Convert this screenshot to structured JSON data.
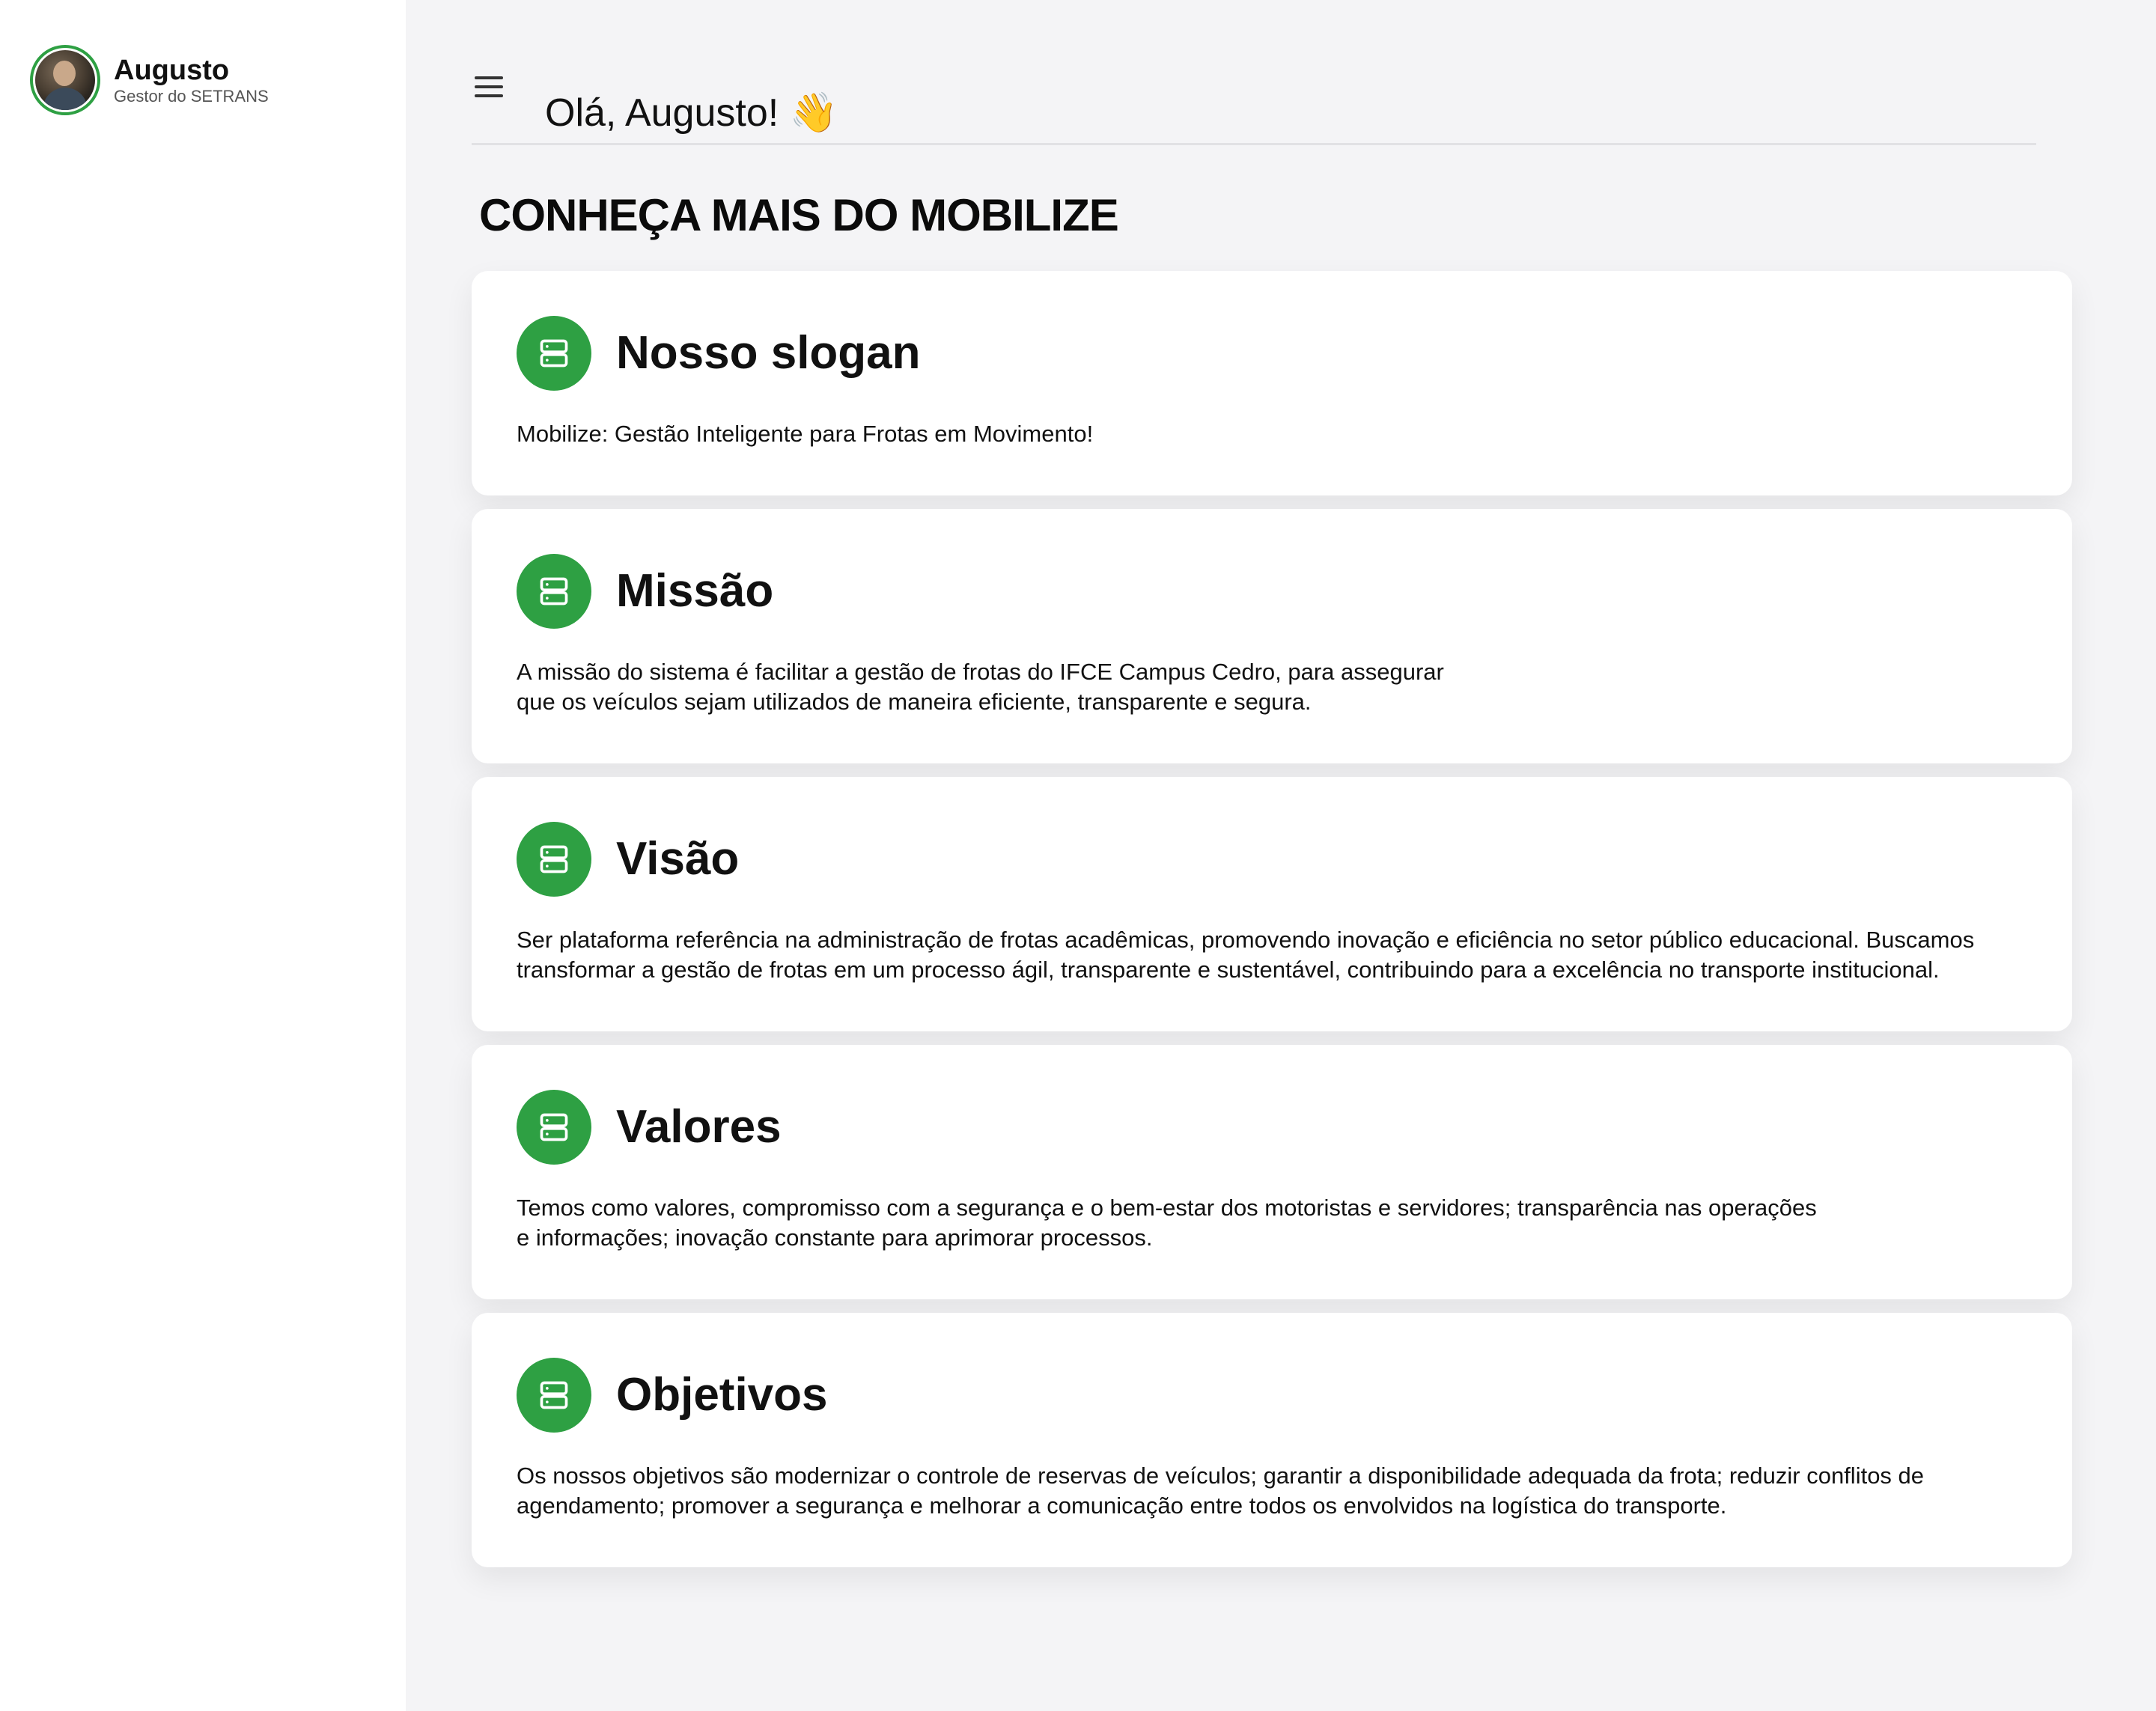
{
  "user": {
    "name": "Augusto",
    "role": "Gestor do SETRANS"
  },
  "header": {
    "greeting": "Olá, Augusto! 👋"
  },
  "main": {
    "section_title": "CONHEÇA MAIS DO MOBILIZE",
    "cards": [
      {
        "title": "Nosso slogan",
        "lines": [
          "Mobilize: Gestão Inteligente para Frotas em Movimento!"
        ]
      },
      {
        "title": "Missão",
        "lines": [
          "A missão do sistema é facilitar a gestão de frotas do IFCE Campus Cedro, para assegurar",
          "que os veículos sejam utilizados de maneira eficiente, transparente e segura."
        ]
      },
      {
        "title": "Visão",
        "lines": [
          "Ser plataforma referência na administração de frotas acadêmicas, promovendo inovação e eficiência no setor público educacional. Buscamos",
          "transformar a gestão de frotas em um processo ágil, transparente e sustentável, contribuindo para a excelência no transporte institucional."
        ]
      },
      {
        "title": "Valores",
        "lines": [
          "Temos como valores, compromisso com a segurança e o bem-estar dos motoristas e servidores; transparência nas operações",
          "e informações; inovação constante para aprimorar processos."
        ]
      },
      {
        "title": "Objetivos",
        "lines": [
          "Os nossos objetivos são modernizar o controle de reservas de veículos; garantir a disponibilidade adequada da frota; reduzir conflitos de",
          "agendamento; promover a segurança e melhorar a comunicação entre todos os envolvidos na logística do transporte."
        ]
      }
    ]
  },
  "icons": {
    "menu": "menu-icon",
    "card": "server-icon"
  },
  "colors": {
    "accent": "#2ea043",
    "background": "#f4f4f6",
    "card": "#ffffff"
  }
}
